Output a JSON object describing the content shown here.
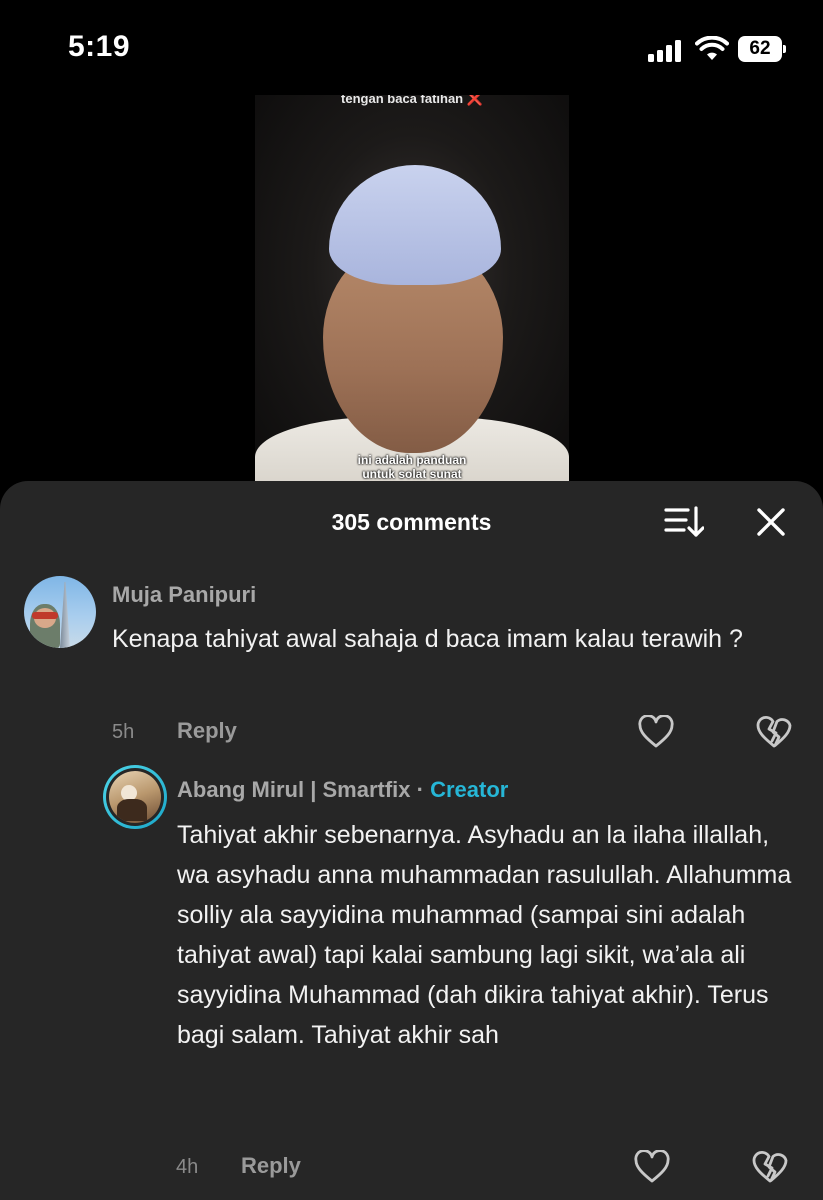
{
  "status_bar": {
    "time": "5:19",
    "battery_level": "62",
    "icons": [
      "signal-icon",
      "wifi-icon",
      "battery-icon"
    ]
  },
  "video": {
    "top_caption": "tengan baca fatihan",
    "top_caption_emoji": "❌",
    "subtitle_line1": "ini adalah panduan",
    "subtitle_line2": "untuk solat sunat"
  },
  "comments_sheet": {
    "count_label": "305 comments",
    "icons": [
      "sort-icon",
      "close-icon"
    ],
    "comments": [
      {
        "username": "Muja Panipuri",
        "text": "Kenapa tahiyat awal sahaja d baca imam kalau terawih ?",
        "time": "5h",
        "reply_label": "Reply"
      }
    ],
    "reply": {
      "username": "Abang Mirul | Smartfix",
      "separator": " · ",
      "badge": "Creator",
      "text": "Tahiyat akhir sebenarnya. Asyhadu an la ilaha illallah, wa asyhadu anna muhammadan rasulullah. Allahumma solliy ala sayyidina muhammad (sampai sini adalah tahiyat awal) tapi kalai sambung lagi sikit, wa’ala ali sayyidina Muhammad (dah dikira tahiyat akhir). Terus bagi salam. Tahiyat akhir sah",
      "time": "4h",
      "reply_label": "Reply"
    }
  },
  "colors": {
    "sheet_background": "#262626",
    "creator_accent": "#26b6d6",
    "username_gray": "#a8a8a8"
  }
}
